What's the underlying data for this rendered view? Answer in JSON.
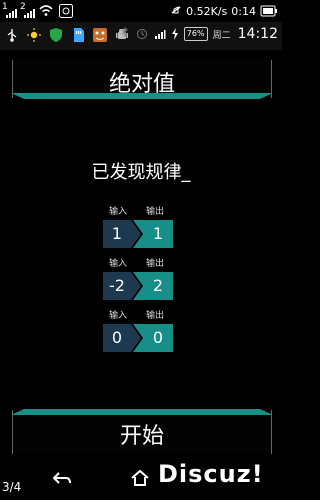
{
  "status": {
    "sim1": "1",
    "sim2": "2",
    "speed": "0.52K/s",
    "time": "0:14"
  },
  "inner_status": {
    "battery_badge": "76%",
    "day_label": "周二",
    "time": "14:12"
  },
  "screen": {
    "title": "绝对值",
    "discovered": "已发现规律_",
    "examples": [
      {
        "input_label": "输入",
        "output_label": "输出",
        "input": "1",
        "output": "1"
      },
      {
        "input_label": "输入",
        "output_label": "输出",
        "input": "-2",
        "output": "2"
      },
      {
        "input_label": "输入",
        "output_label": "输出",
        "input": "0",
        "output": "0"
      }
    ],
    "start": "开始"
  },
  "bottom": {
    "page_counter": "3/4",
    "watermark": "Discuz!"
  },
  "colors": {
    "teal": "#178f88",
    "navy": "#1d3950"
  },
  "icons": {
    "wifi": "wifi-icon",
    "gear": "gear-icon",
    "battery": "battery-icon",
    "usb": "usb-icon",
    "sun": "sun-icon",
    "shield": "shield-icon",
    "sd": "sd-card-icon",
    "android": "android-icon",
    "bluetooth": "bluetooth-icon",
    "alarm": "alarm-icon",
    "signal": "signal-icon",
    "bolt": "bolt-icon",
    "back": "back-icon",
    "home": "home-icon"
  }
}
